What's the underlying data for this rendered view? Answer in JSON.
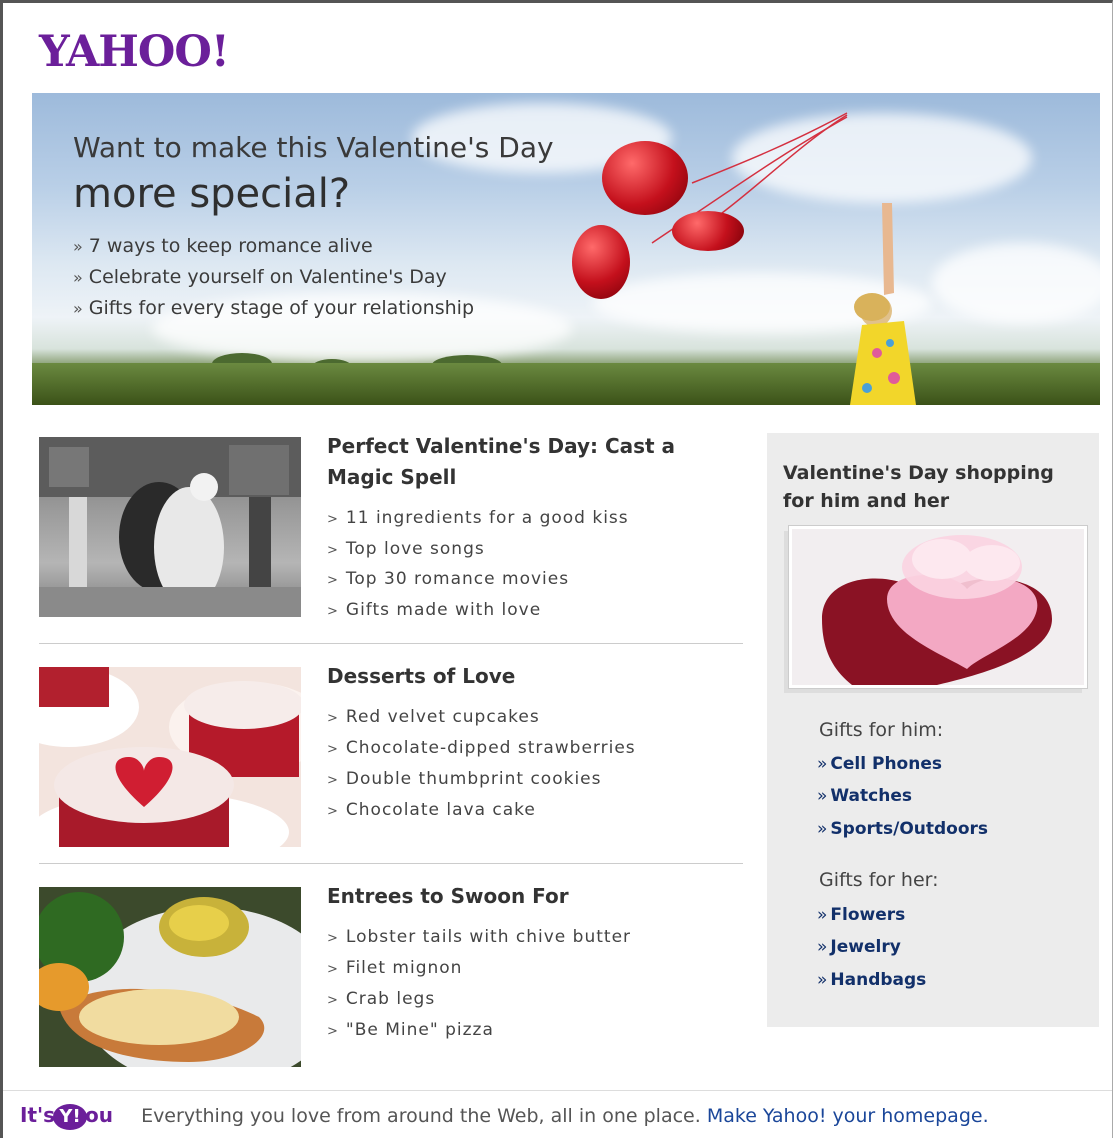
{
  "logo": "YAHOO!",
  "hero": {
    "line1": "Want to make this Valentine's Day",
    "line2": "more special?",
    "links": [
      "7 ways to keep romance alive",
      "Celebrate yourself on Valentine's Day",
      "Gifts for every stage of your relationship"
    ]
  },
  "articles": [
    {
      "title": "Perfect Valentine's Day: Cast a Magic Spell",
      "links": [
        "11 ingredients for a good kiss",
        "Top love songs",
        "Top 30 romance movies",
        "Gifts made with love"
      ]
    },
    {
      "title": "Desserts of Love",
      "links": [
        "Red velvet cupcakes",
        "Chocolate-dipped strawberries",
        "Double thumbprint cookies",
        "Chocolate lava cake"
      ]
    },
    {
      "title": "Entrees to Swoon For",
      "links": [
        "Lobster tails with chive butter",
        "Filet mignon",
        "Crab legs",
        "\"Be Mine\" pizza"
      ]
    }
  ],
  "sidebar": {
    "title": "Valentine's Day shopping for him and her",
    "him_heading": "Gifts for him:",
    "him_links": [
      "Cell Phones",
      "Watches",
      "Sports/Outdoors"
    ],
    "her_heading": "Gifts for her:",
    "her_links": [
      "Flowers",
      "Jewelry",
      "Handbags"
    ]
  },
  "footer": {
    "its": "It's",
    "y": "Y!",
    "ou": "ou",
    "message": "Everything you love from around the Web, all in one place.",
    "cta": "Make Yahoo! your homepage."
  },
  "raquo": "»",
  "gt": ">"
}
